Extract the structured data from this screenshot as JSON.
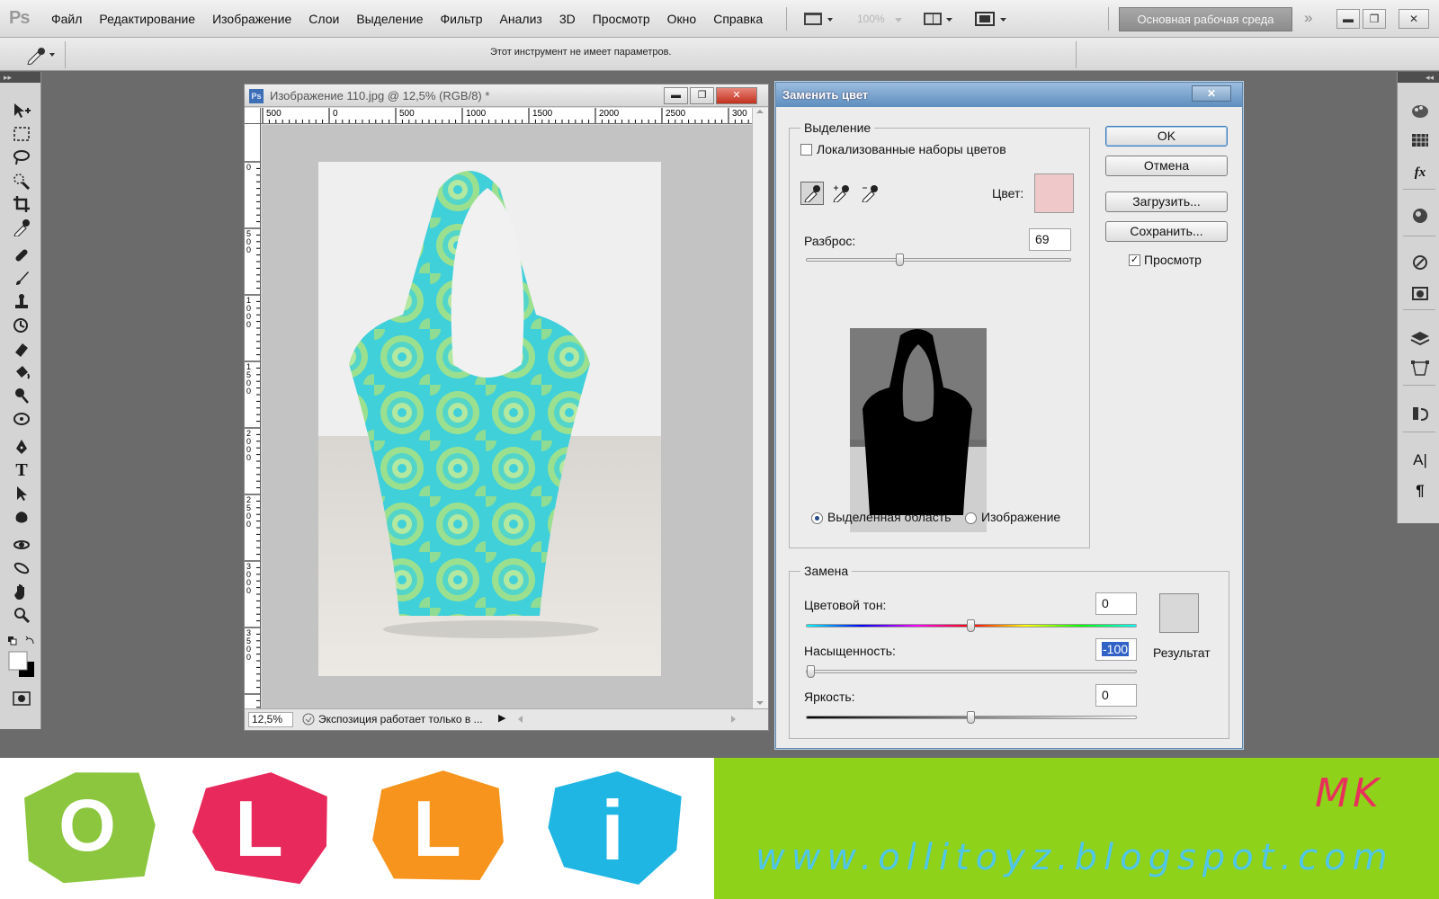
{
  "menubar": {
    "logo": "Ps",
    "items": [
      "Файл",
      "Редактирование",
      "Изображение",
      "Слои",
      "Выделение",
      "Фильтр",
      "Анализ",
      "3D",
      "Просмотр",
      "Окно",
      "Справка"
    ],
    "zoom": "100%",
    "workspace": "Основная рабочая среда",
    "more": "»"
  },
  "options_bar": {
    "message": "Этот инструмент не имеет параметров."
  },
  "document": {
    "title": "Изображение 110.jpg @ 12,5% (RGB/8) *",
    "ruler_top": [
      "500",
      "0",
      "500",
      "1000",
      "1500",
      "2000",
      "2500",
      "300"
    ],
    "ruler_left": [
      "0",
      "500",
      "1000",
      "1500",
      "2000",
      "2500",
      "3000",
      "3500"
    ],
    "zoom": "12,5%",
    "status": "Экспозиция работает только в ..."
  },
  "dialog": {
    "title": "Заменить цвет",
    "selection": {
      "legend": "Выделение",
      "localized_label": "Локализованные наборы цветов",
      "localized_checked": false,
      "color_label": "Цвет:",
      "color_swatch": "#efc9c9",
      "fuzziness_label": "Разброс:",
      "fuzziness_value": "69",
      "fuzziness_level": 0.35,
      "radio_selection": "Выделенная область",
      "radio_image": "Изображение",
      "radio_selected": "selection"
    },
    "buttons": {
      "ok": "OK",
      "cancel": "Отмена",
      "load": "Загрузить...",
      "save": "Сохранить..."
    },
    "preview_label": "Просмотр",
    "preview_checked": true,
    "replacement": {
      "legend": "Замена",
      "hue_label": "Цветовой тон:",
      "hue_value": "0",
      "hue_level": 0.5,
      "saturation_label": "Насыщенность:",
      "saturation_value": "-100",
      "saturation_level": 0.0,
      "lightness_label": "Яркость:",
      "lightness_value": "0",
      "lightness_level": 0.5,
      "result_label": "Результат",
      "result_swatch": "#d8d8d8"
    }
  },
  "banner": {
    "logo_letters": [
      "O",
      "L",
      "L",
      "i"
    ],
    "logo_colors": [
      "#8cc63f",
      "#e8295b",
      "#f7941d",
      "#1fb6e4"
    ],
    "mk": "MK",
    "url": "www.ollitoyz.blogspot.com"
  },
  "colors": {
    "banner_green": "#8fd21a",
    "accent_pink": "#e8315a",
    "accent_cyan": "#4fc6e8"
  }
}
